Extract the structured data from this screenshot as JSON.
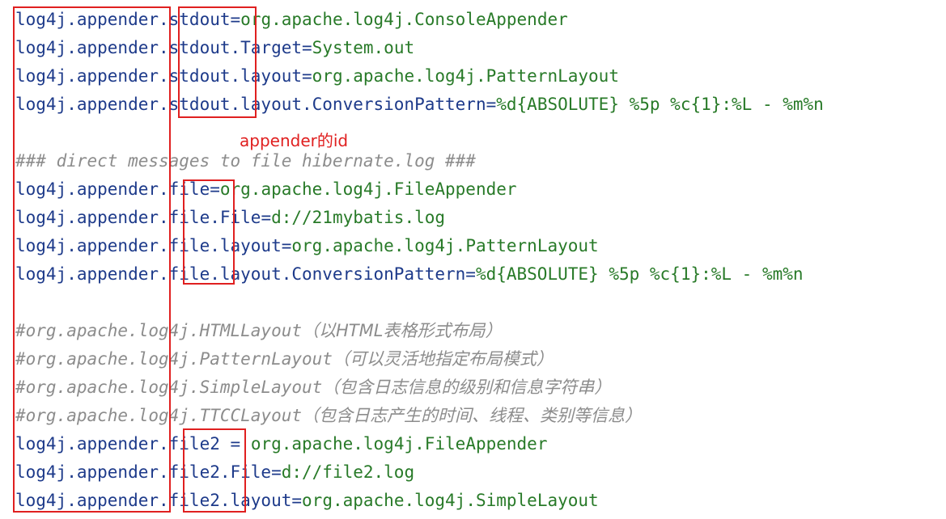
{
  "lines": [
    {
      "key": "log4j.appender.stdout",
      "sep": "=",
      "value": "org.apache.log4j.ConsoleAppender"
    },
    {
      "key": "log4j.appender.stdout.Target",
      "sep": "=",
      "value": "System.out"
    },
    {
      "key": "log4j.appender.stdout.layout",
      "sep": "=",
      "value": "org.apache.log4j.PatternLayout"
    },
    {
      "key": "log4j.appender.stdout.layout.ConversionPattern",
      "sep": "=",
      "value": "%d{ABSOLUTE} %5p %c{1}:%L - %m%n"
    },
    {
      "comment": "### direct messages to file hibernate.log ###"
    },
    {
      "key": "log4j.appender.file",
      "sep": "=",
      "value": "org.apache.log4j.FileAppender"
    },
    {
      "key": "log4j.appender.file.File",
      "sep": "=",
      "value": "d://21mybatis.log"
    },
    {
      "key": "log4j.appender.file.layout",
      "sep": "=",
      "value": "org.apache.log4j.PatternLayout"
    },
    {
      "key": "log4j.appender.file.layout.ConversionPattern",
      "sep": "=",
      "value": "%d{ABSOLUTE} %5p %c{1}:%L - %m%n"
    },
    {
      "comment": "#org.apache.log4j.HTMLLayout",
      "note": "（以HTML表格形式布局）"
    },
    {
      "comment": "#org.apache.log4j.PatternLayout",
      "note": "（可以灵活地指定布局模式）"
    },
    {
      "comment": "#org.apache.log4j.SimpleLayout",
      "note": "（包含日志信息的级别和信息字符串）"
    },
    {
      "comment": "#org.apache.log4j.TTCCLayout",
      "note": "（包含日志产生的时间、线程、类别等信息）"
    },
    {
      "key": "log4j.appender.file2",
      "sep": " = ",
      "value": "org.apache.log4j.FileAppender"
    },
    {
      "key": "log4j.appender.file2.File",
      "sep": "=",
      "value": "d://file2.log"
    },
    {
      "key": "log4j.appender.file2.layout",
      "sep": "=",
      "value": "org.apache.log4j.SimpleLayout"
    }
  ],
  "annotation": "appender的id",
  "colors": {
    "key": "#1d3a8a",
    "value": "#287a28",
    "comment": "#8c8c8c",
    "annotation": "#e02020"
  }
}
